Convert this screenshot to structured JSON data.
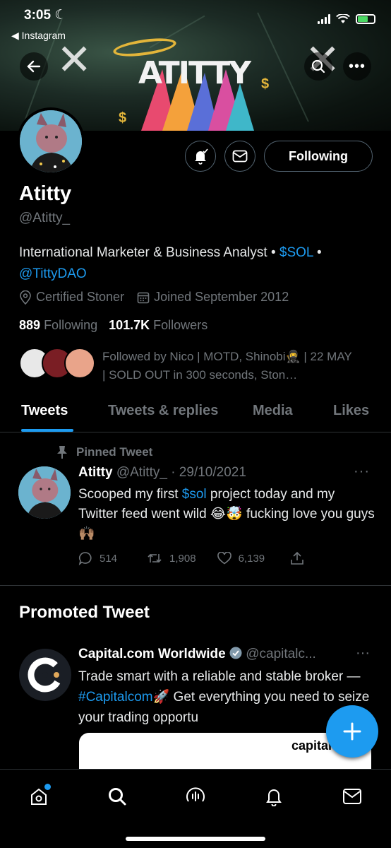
{
  "status_bar": {
    "time": "3:05",
    "back_app": "◀ Instagram"
  },
  "banner": {
    "art_text": "ATITTY",
    "dollar_glyph": "$"
  },
  "profile": {
    "name": "Atitty",
    "handle": "@Atitty_",
    "bio_text": "International Marketer & Business Analyst • ",
    "bio_link1": "$SOL",
    "bio_sep": " • ",
    "bio_link2": "@TittyDAO",
    "location": "Certified Stoner",
    "joined": "Joined September 2012",
    "following_count": "889",
    "following_label": "Following",
    "followers_count": "101.7K",
    "followers_label": "Followers",
    "followed_by": "Followed by Nico | MOTD, Shinobi🥷 | 22 MAY | SOLD OUT in 300 seconds, Ston…",
    "following_button": "Following"
  },
  "tabs": [
    {
      "label": "Tweets"
    },
    {
      "label": "Tweets & replies"
    },
    {
      "label": "Media"
    },
    {
      "label": "Likes"
    }
  ],
  "pinned_tweet": {
    "pinned_label": "Pinned Tweet",
    "author": "Atitty",
    "handle_date": " @Atitty_ · 29/10/2021",
    "body_pre": "Scooped my first ",
    "body_link": "$sol",
    "body_post": " project today and my Twitter feed went wild 😂🤯 fucking love you guys 🙌🏽",
    "replies": "514",
    "retweets": "1,908",
    "likes": "6,139"
  },
  "promoted": {
    "heading": "Promoted Tweet",
    "author": "Capital.com Worldwide",
    "handle": " @capitalc...",
    "body_pre": "Trade smart with a reliable and stable broker — ",
    "body_link": "#Capitalcom",
    "body_post": "🚀 Get everything you need to seize your trading opportu",
    "card_text": "capital"
  },
  "colors": {
    "accent": "#1d9bf0",
    "background": "#000000",
    "muted": "#71767b"
  }
}
